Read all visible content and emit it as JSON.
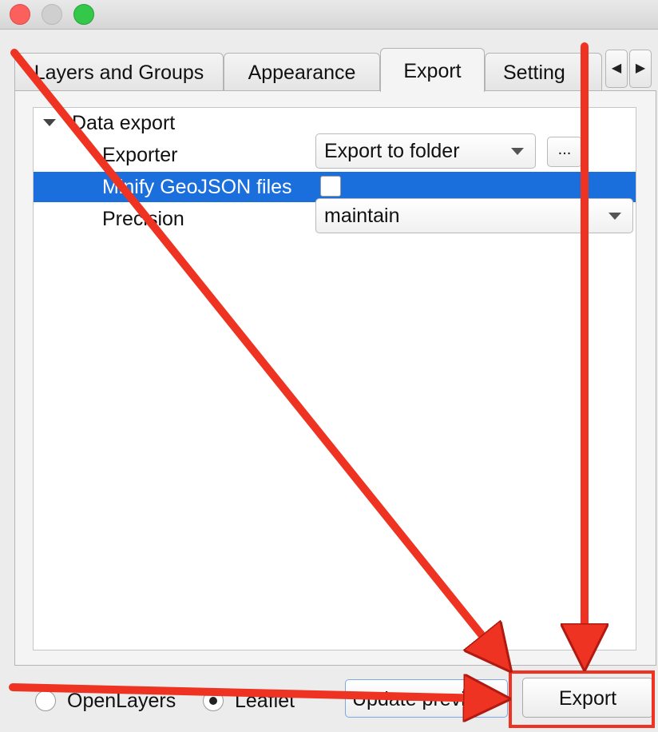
{
  "tabs": [
    {
      "label": "Layers and Groups",
      "active": false
    },
    {
      "label": "Appearance",
      "active": false
    },
    {
      "label": "Export",
      "active": true
    },
    {
      "label": "Setting",
      "active": false
    }
  ],
  "tab_scroll": {
    "left_icon": "chevron-left-icon",
    "right_icon": "chevron-right-icon",
    "left_glyph": "◀",
    "right_glyph": "▶"
  },
  "tree": {
    "group_label": "Data export",
    "rows": [
      {
        "label": "Exporter",
        "control": "Export to folder",
        "button": "..."
      },
      {
        "label": "Minify GeoJSON files",
        "checked": false,
        "selected": true
      },
      {
        "label": "Precision",
        "control": "maintain"
      }
    ]
  },
  "bottom": {
    "radio_openlayers": "OpenLayers",
    "radio_leaflet": "Leaflet",
    "selected_renderer": "Leaflet",
    "update_preview": "Update preview",
    "export_button": "Export"
  },
  "colors": {
    "selection": "#1a6fdc",
    "annotation_red": "#ee3322"
  }
}
